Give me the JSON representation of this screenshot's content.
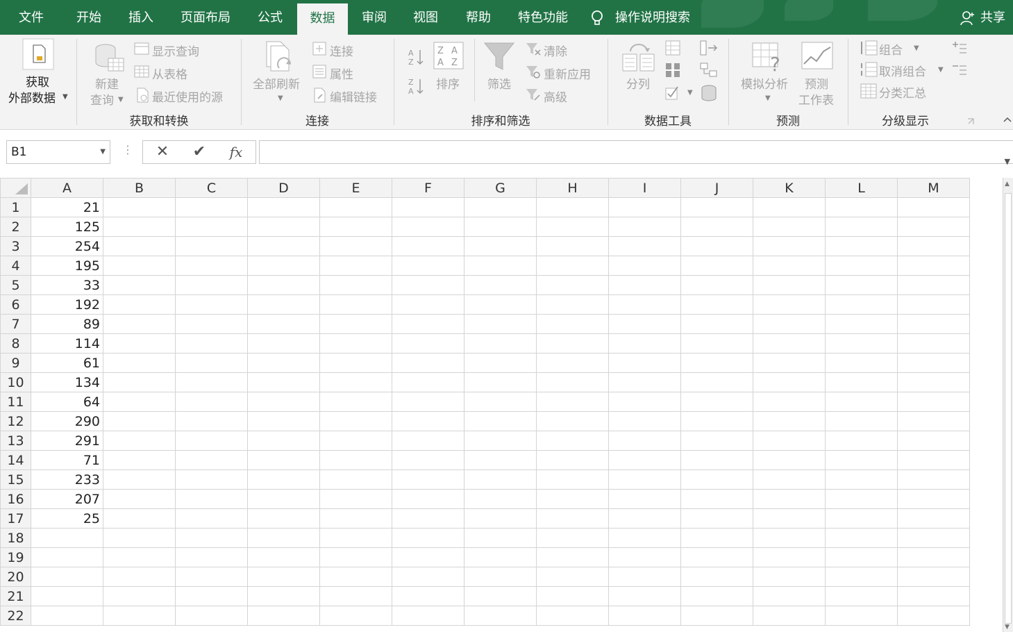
{
  "tabs": [
    {
      "label": "文件"
    },
    {
      "label": "开始"
    },
    {
      "label": "插入"
    },
    {
      "label": "页面布局"
    },
    {
      "label": "公式"
    },
    {
      "label": "数据"
    },
    {
      "label": "审阅"
    },
    {
      "label": "视图"
    },
    {
      "label": "帮助"
    },
    {
      "label": "特色功能"
    }
  ],
  "active_tab": "数据",
  "tell_me": "操作说明搜索",
  "share": "共享",
  "ribbon": {
    "get_external": {
      "line1": "获取",
      "line2": "外部数据"
    },
    "get_transform": {
      "new_query": {
        "line1": "新建",
        "line2": "查询"
      },
      "show_queries": "显示查询",
      "from_table": "从表格",
      "recent_sources": "最近使用的源",
      "label": "获取和转换"
    },
    "connections": {
      "refresh_all": "全部刷新",
      "connections": "连接",
      "properties": "属性",
      "edit_links": "编辑链接",
      "label": "连接"
    },
    "sort_filter": {
      "sort": "排序",
      "filter": "筛选",
      "clear": "清除",
      "reapply": "重新应用",
      "advanced": "高级",
      "label": "排序和筛选"
    },
    "data_tools": {
      "text_to_columns": "分列",
      "label": "数据工具"
    },
    "forecast": {
      "what_if": "模拟分析",
      "forecast_sheet": {
        "line1": "预测",
        "line2": "工作表"
      },
      "label": "预测"
    },
    "outline": {
      "group": "组合",
      "ungroup": "取消组合",
      "subtotal": "分类汇总",
      "label": "分级显示"
    }
  },
  "formula_bar": {
    "name_box": "B1",
    "formula": ""
  },
  "sheet": {
    "columns": [
      "A",
      "B",
      "C",
      "D",
      "E",
      "F",
      "G",
      "H",
      "I",
      "J",
      "K",
      "L",
      "M"
    ],
    "rows": [
      {
        "num": "1",
        "a": "21"
      },
      {
        "num": "2",
        "a": "125"
      },
      {
        "num": "3",
        "a": "254"
      },
      {
        "num": "4",
        "a": "195"
      },
      {
        "num": "5",
        "a": "33"
      },
      {
        "num": "6",
        "a": "192"
      },
      {
        "num": "7",
        "a": "89"
      },
      {
        "num": "8",
        "a": "114"
      },
      {
        "num": "9",
        "a": "61"
      },
      {
        "num": "10",
        "a": "134"
      },
      {
        "num": "11",
        "a": "64"
      },
      {
        "num": "12",
        "a": "290"
      },
      {
        "num": "13",
        "a": "291"
      },
      {
        "num": "14",
        "a": "71"
      },
      {
        "num": "15",
        "a": "233"
      },
      {
        "num": "16",
        "a": "207"
      },
      {
        "num": "17",
        "a": "25"
      },
      {
        "num": "18",
        "a": ""
      },
      {
        "num": "19",
        "a": ""
      },
      {
        "num": "20",
        "a": ""
      },
      {
        "num": "21",
        "a": ""
      },
      {
        "num": "22",
        "a": ""
      }
    ]
  },
  "colors": {
    "accent": "#217346",
    "ribbon_bg": "#f3f3f3",
    "disabled_text": "#a6a6a6",
    "gridline": "#d4d4d4"
  }
}
